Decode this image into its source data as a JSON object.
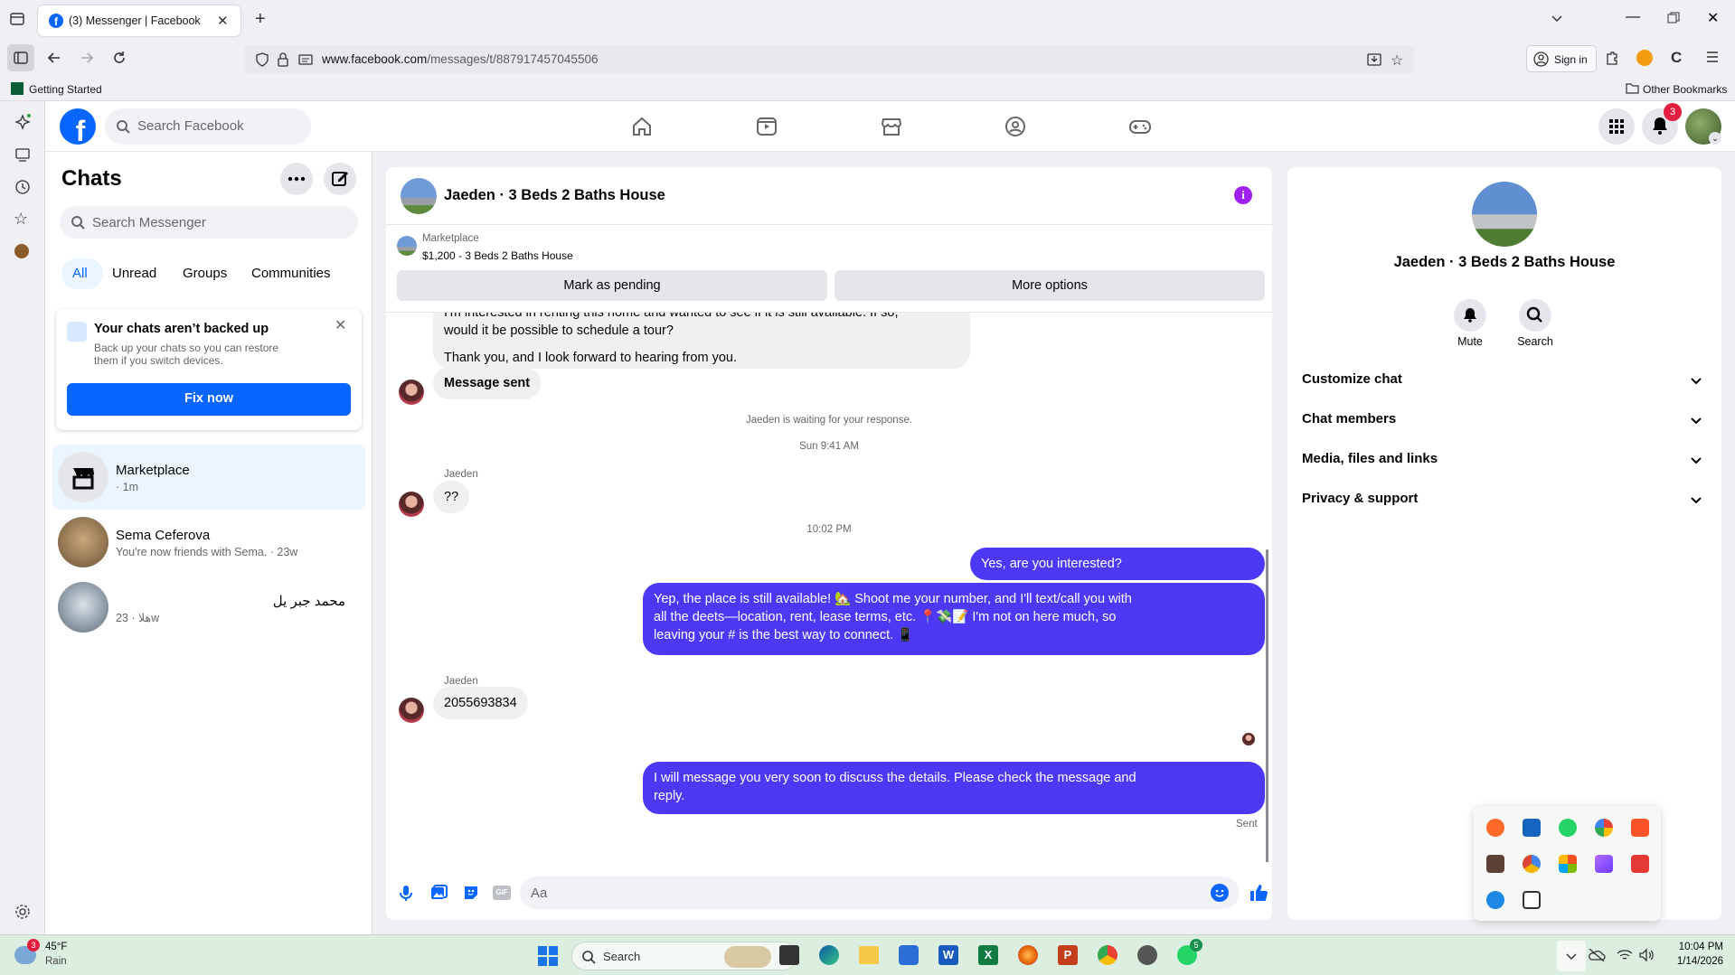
{
  "browser": {
    "tab_title": "(3) Messenger | Facebook",
    "url_domain": "www.facebook.com",
    "url_path": "/messages/t/887917457045506",
    "sign_in": "Sign in",
    "bookmark_getting_started": "Getting Started",
    "bookmark_other": "Other Bookmarks"
  },
  "fb": {
    "search_placeholder": "Search Facebook",
    "notif_count": "3"
  },
  "chats": {
    "title": "Chats",
    "search_placeholder": "Search Messenger",
    "filters": [
      "All",
      "Unread",
      "Groups",
      "Communities"
    ],
    "backup_title": "Your chats aren’t backed up",
    "backup_text_1": "Back up your chats so you can restore",
    "backup_text_2": "them if you switch devices.",
    "backup_button": "Fix now",
    "items": [
      {
        "name": "Marketplace",
        "sub": "· 1m"
      },
      {
        "name": "Sema Ceferova",
        "sub": "You're now friends with Sema. · 23w"
      },
      {
        "name": "محمد جبر يل",
        "sub": "هلا · 23w"
      }
    ]
  },
  "convo": {
    "title": "Jaeden · 3 Beds 2 Baths House",
    "mp_label": "Marketplace",
    "mp_listing": "$1,200 - 3 Beds 2 Baths House",
    "btn_pending": "Mark as pending",
    "btn_more": "More options",
    "msg1_line1": "I'm interested in renting this home and wanted to see if it is still available. If so,",
    "msg1_line2": "would it be possible to schedule a tour?",
    "msg1_line3": "Thank you, and I look forward to hearing from you.",
    "msg_sent": "Message sent",
    "waiting": "Jaeden is waiting for your response.",
    "time1": "Sun 9:41 AM",
    "sender1": "Jaeden",
    "msg_qq": "??",
    "time2": "10:02 PM",
    "out1": "Yes, are you interested?",
    "out2_line1": "Yep, the place is still available! 🏡 Shoot me your number, and I'll text/call you with",
    "out2_line2": "all the deets—location, rent, lease terms, etc. 📍💸📝 I'm not on here much, so",
    "out2_line3": "leaving your # is the best way to connect. 📱",
    "sender2": "Jaeden",
    "msg_number": "2055693834",
    "out3_line1": "I will message you very soon to discuss the details. Please check the message and",
    "out3_line2": "reply.",
    "status_sent": "Sent",
    "composer_placeholder": "Aa"
  },
  "info": {
    "title": "Jaeden · 3 Beds 2 Baths House",
    "mute": "Mute",
    "search": "Search",
    "sections": [
      "Customize chat",
      "Chat members",
      "Media, files and links",
      "Privacy & support"
    ]
  },
  "taskbar": {
    "weather_temp": "45°F",
    "weather_desc": "Rain",
    "weather_badge": "3",
    "search": "Search",
    "whatsapp_badge": "5",
    "time": "10:04 PM",
    "date": "1/14/2026"
  },
  "colors": {
    "fb_blue": "#0866ff",
    "bubble_out": "#4d38f5",
    "notif_red": "#e41e3f"
  }
}
